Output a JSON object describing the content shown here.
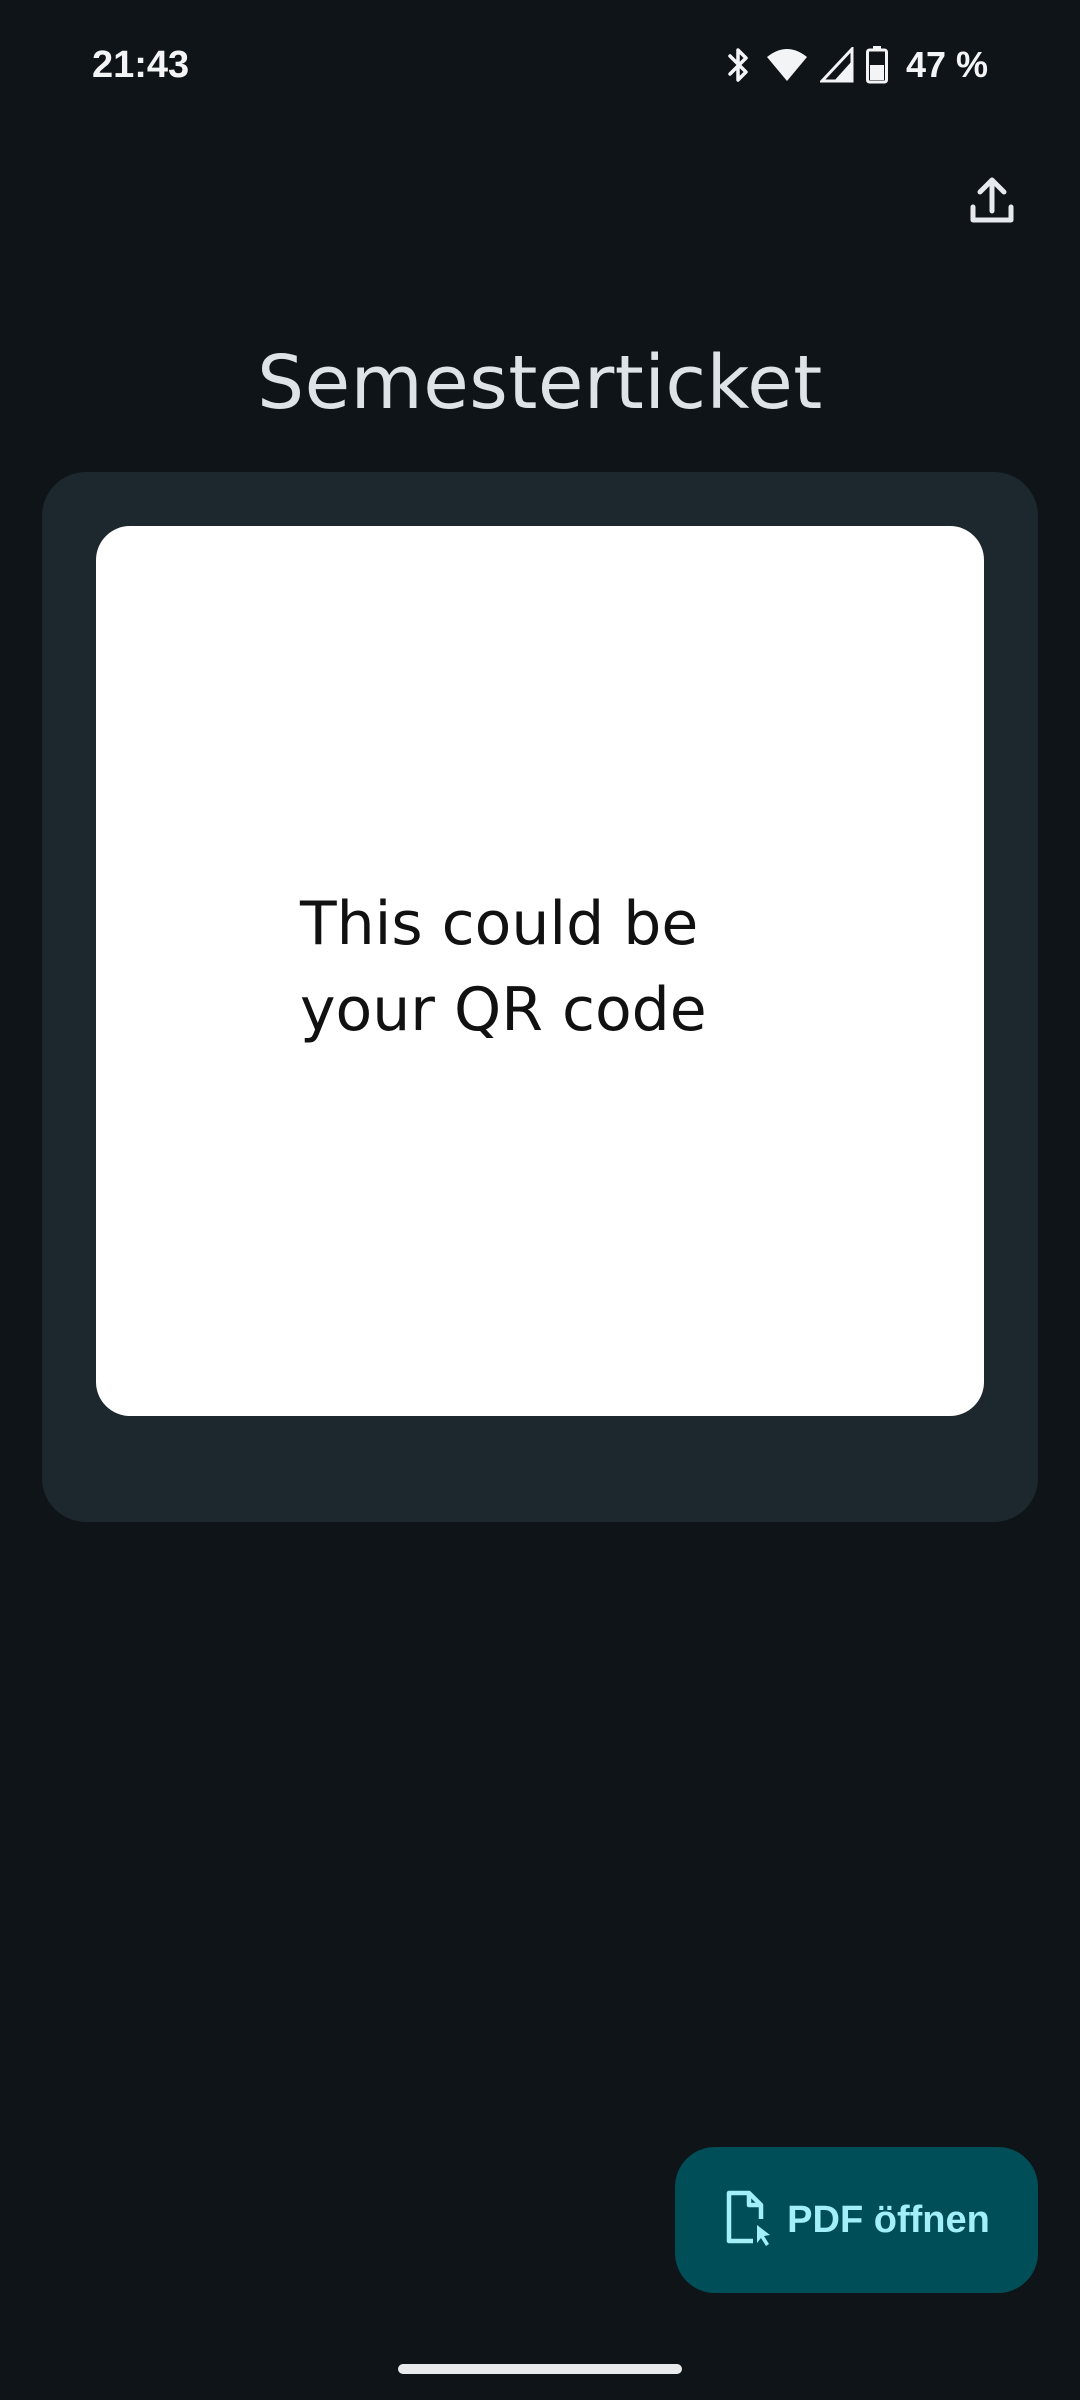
{
  "status_bar": {
    "time": "21:43",
    "battery": "47 %",
    "icons": [
      "bluetooth-icon",
      "wifi-icon",
      "cellular-signal-icon",
      "battery-icon"
    ]
  },
  "toolbar": {
    "share_icon": "share-upload-icon"
  },
  "page": {
    "title": "Semesterticket"
  },
  "ticket": {
    "qr_placeholder_line1": "This could be",
    "qr_placeholder_line2": "your QR code"
  },
  "fab": {
    "icon": "file-open-icon",
    "label": "PDF öffnen"
  },
  "colors": {
    "background": "#0f1418",
    "card": "#1c282d",
    "fab_background": "#004f58",
    "fab_text": "#a3eff7"
  }
}
